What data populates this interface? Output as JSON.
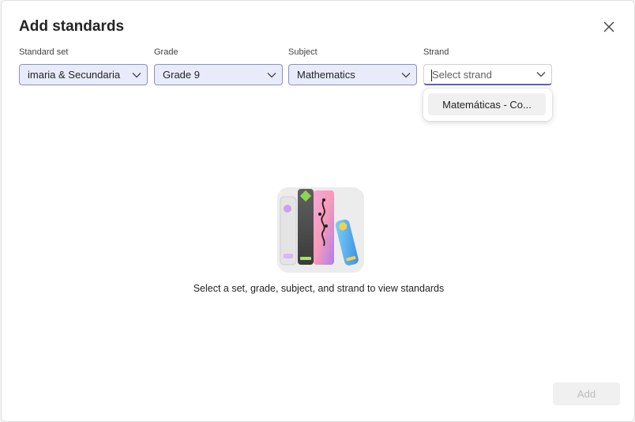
{
  "dialog": {
    "title": "Add standards",
    "close_icon": "close-icon"
  },
  "filters": {
    "standard_set": {
      "label": "Standard set",
      "value": "imaria & Secundaria"
    },
    "grade": {
      "label": "Grade",
      "value": "Grade 9"
    },
    "subject": {
      "label": "Subject",
      "value": "Mathematics"
    },
    "strand": {
      "label": "Strand",
      "placeholder": "Select strand"
    }
  },
  "strand_dropdown": {
    "options": [
      "Matemáticas - Co..."
    ]
  },
  "empty_state": {
    "illustration": "books-illustration",
    "message": "Select a set, grade, subject, and strand to view standards"
  },
  "footer": {
    "add_label": "Add"
  },
  "colors": {
    "accent": "#5b5fc7",
    "select_bg": "#e8ebfa"
  }
}
